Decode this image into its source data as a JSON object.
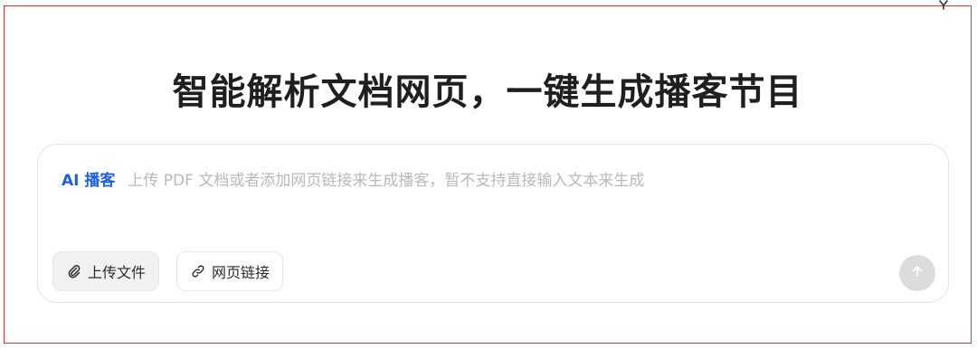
{
  "header": {
    "title": "智能解析文档网页，一键生成播客节目"
  },
  "composer": {
    "mode_tag": "AI 播客",
    "placeholder": "上传 PDF 文档或者添加网页链接来生成播客，暂不支持直接输入文本来生成",
    "upload_button": {
      "label": "上传文件",
      "icon": "paperclip-icon"
    },
    "link_button": {
      "label": "网页链接",
      "icon": "link-icon"
    },
    "send_button": {
      "icon": "arrow-up-icon",
      "state": "disabled"
    }
  },
  "colors": {
    "frame_border": "#d93a3a",
    "accent": "#1e5fe8",
    "placeholder": "#b9b9b9",
    "send_disabled": "#dcdcdc"
  }
}
